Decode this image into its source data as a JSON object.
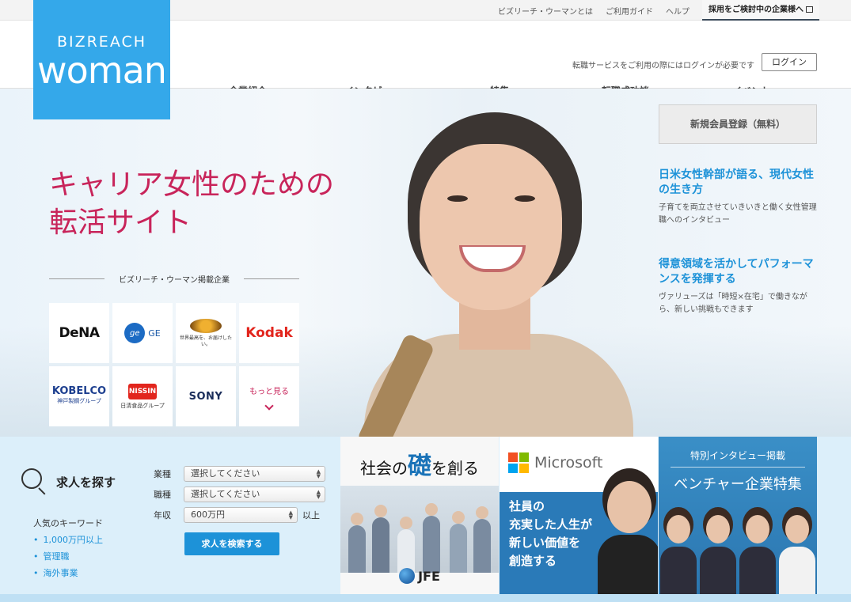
{
  "topbar": {
    "links": [
      "ビズリーチ・ウーマンとは",
      "ご利用ガイド",
      "ヘルプ"
    ],
    "corporate_link": "採用をご検討中の企業様へ"
  },
  "logo": {
    "brand": "BIZREACH",
    "word": "woman"
  },
  "header": {
    "login_note": "転職サービスをご利用の際にはログインが必要です",
    "login_button": "ログイン"
  },
  "nav": {
    "items": [
      "企業紹介",
      "インタビュー",
      "特集",
      "転職成功談",
      "イベント"
    ]
  },
  "hero": {
    "copy_line1": "キャリア女性のための",
    "copy_line2": "転活サイト",
    "companies_heading": "ビズリーチ・ウーマン掲載企業",
    "companies": [
      "DeNA",
      "GE",
      "USJ",
      "Kodak",
      "KOBELCO",
      "NISSIN",
      "SONY"
    ],
    "usj_tagline": "世界最高を、お届けしたい。",
    "kobelco_sub": "神戸製鋼グループ",
    "nissin_sub": "日清食品グループ",
    "more_label": "もっと見る"
  },
  "side": {
    "register_button": "新規会員登録（無料）",
    "features": [
      {
        "title": "日米女性幹部が語る、現代女性の生き方",
        "sub": "子育てを両立させていきいきと働く女性管理職へのインタビュー"
      },
      {
        "title": "得意領域を活かしてパフォーマンスを発揮する",
        "sub": "ヴァリューズは「時短×在宅」で働きながら、新しい挑戦もできます"
      }
    ]
  },
  "search": {
    "title": "求人を探す",
    "fields": [
      {
        "label": "業種",
        "value": "選択してください"
      },
      {
        "label": "職種",
        "value": "選択してください"
      },
      {
        "label": "年収",
        "value": "600万円",
        "suffix": "以上"
      }
    ],
    "button": "求人を検索する",
    "keywords_title": "人気のキーワード",
    "keywords": [
      "1,000万円以上",
      "管理職",
      "海外事業"
    ]
  },
  "banners": {
    "jfe": {
      "pre": "社会の",
      "big": "礎",
      "post": "を創る",
      "brand": "JFE"
    },
    "microsoft": {
      "brand": "Microsoft",
      "copy": [
        "社員の",
        "充実した人生が",
        "新しい価値を",
        "創造する"
      ]
    },
    "venture": {
      "top": "特別インタビュー掲載",
      "main": "ベンチャー企業特集"
    }
  },
  "colors": {
    "accent_blue": "#1d92d8",
    "logo_blue": "#34a8ea",
    "hero_pink": "#c8245a"
  }
}
